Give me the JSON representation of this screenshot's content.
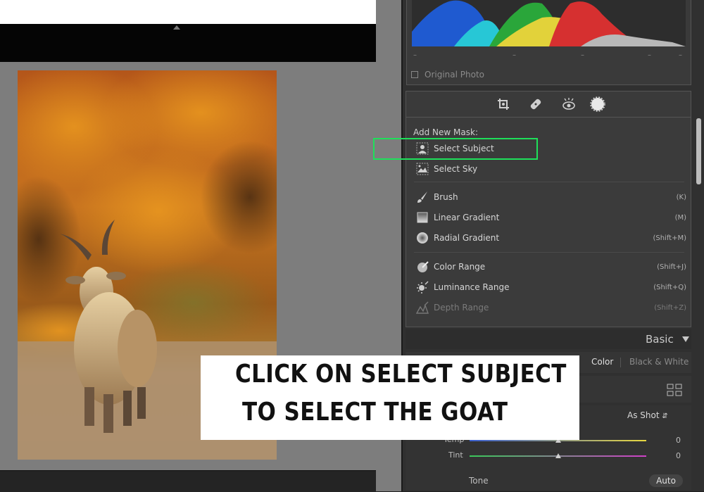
{
  "histogram": {
    "original_photo_label": "Original Photo",
    "tick_marks": [
      "–",
      "–",
      "–",
      "–",
      "–"
    ]
  },
  "tool_strip": {
    "icons": [
      "crop-icon",
      "healing-icon",
      "red-eye-icon",
      "masking-icon"
    ]
  },
  "mask_panel": {
    "heading": "Add New Mask:",
    "items": [
      {
        "label": "Select Subject",
        "shortcut": "",
        "icon": "person-icon"
      },
      {
        "label": "Select Sky",
        "shortcut": "",
        "icon": "sky-icon"
      },
      {
        "label": "Brush",
        "shortcut": "(K)",
        "icon": "brush-icon"
      },
      {
        "label": "Linear Gradient",
        "shortcut": "(M)",
        "icon": "linear-gradient-icon"
      },
      {
        "label": "Radial Gradient",
        "shortcut": "(Shift+M)",
        "icon": "radial-gradient-icon"
      },
      {
        "label": "Color Range",
        "shortcut": "(Shift+J)",
        "icon": "color-range-icon"
      },
      {
        "label": "Luminance Range",
        "shortcut": "(Shift+Q)",
        "icon": "luminance-range-icon"
      },
      {
        "label": "Depth Range",
        "shortcut": "(Shift+Z)",
        "icon": "depth-range-icon"
      }
    ],
    "highlight_color": "#1ee05a"
  },
  "basic_panel": {
    "title": "Basic",
    "treatment_color": "Color",
    "treatment_bw": "Black & White",
    "white_balance_value": "As Shot",
    "sliders": [
      {
        "label": "Temp",
        "value": "0",
        "position": 0.5
      },
      {
        "label": "Tint",
        "value": "0",
        "position": 0.5
      }
    ],
    "tone_label": "Tone",
    "auto_button": "Auto"
  },
  "caption": {
    "line1": "CLICK ON SELECT SUBJECT",
    "line2": "TO SELECT THE GOAT"
  }
}
